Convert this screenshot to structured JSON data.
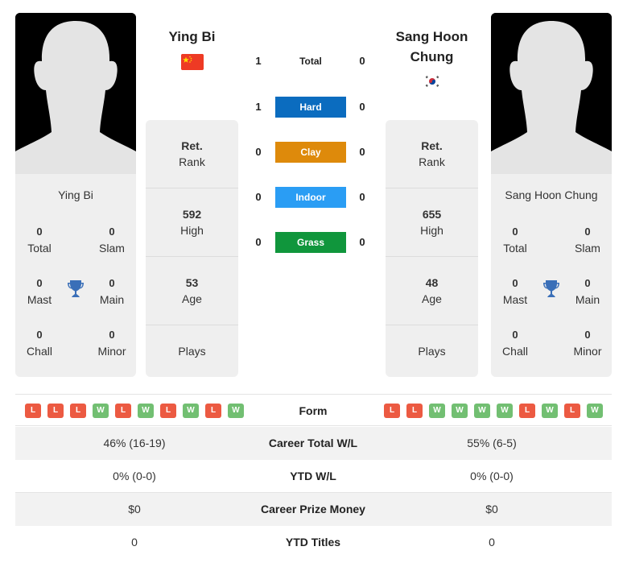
{
  "player1": {
    "name": "Ying Bi",
    "header_name": "Ying Bi",
    "flag": "china-flag",
    "titles": {
      "total": {
        "value": "0",
        "label": "Total"
      },
      "slam": {
        "value": "0",
        "label": "Slam"
      },
      "mast": {
        "value": "0",
        "label": "Mast"
      },
      "main": {
        "value": "0",
        "label": "Main"
      },
      "chall": {
        "value": "0",
        "label": "Chall"
      },
      "minor": {
        "value": "0",
        "label": "Minor"
      }
    },
    "info": {
      "rank": {
        "value": "Ret.",
        "label": "Rank"
      },
      "high": {
        "value": "592",
        "label": "High"
      },
      "age": {
        "value": "53",
        "label": "Age"
      },
      "plays": {
        "value": "",
        "label": "Plays"
      }
    },
    "form": [
      "L",
      "L",
      "L",
      "W",
      "L",
      "W",
      "L",
      "W",
      "L",
      "W"
    ]
  },
  "player2": {
    "name": "Sang Hoon Chung",
    "header_name": "Sang Hoon Chung",
    "flag": "south-korea-flag",
    "titles": {
      "total": {
        "value": "0",
        "label": "Total"
      },
      "slam": {
        "value": "0",
        "label": "Slam"
      },
      "mast": {
        "value": "0",
        "label": "Mast"
      },
      "main": {
        "value": "0",
        "label": "Main"
      },
      "chall": {
        "value": "0",
        "label": "Chall"
      },
      "minor": {
        "value": "0",
        "label": "Minor"
      }
    },
    "info": {
      "rank": {
        "value": "Ret.",
        "label": "Rank"
      },
      "high": {
        "value": "655",
        "label": "High"
      },
      "age": {
        "value": "48",
        "label": "Age"
      },
      "plays": {
        "value": "",
        "label": "Plays"
      }
    },
    "form": [
      "L",
      "L",
      "W",
      "W",
      "W",
      "W",
      "L",
      "W",
      "L",
      "W"
    ]
  },
  "h2h": [
    {
      "label": "Total",
      "p1": "1",
      "p2": "0",
      "color": ""
    },
    {
      "label": "Hard",
      "p1": "1",
      "p2": "0",
      "color": "#0b6cbf"
    },
    {
      "label": "Clay",
      "p1": "0",
      "p2": "0",
      "color": "#de8a0b"
    },
    {
      "label": "Indoor",
      "p1": "0",
      "p2": "0",
      "color": "#2a9df4"
    },
    {
      "label": "Grass",
      "p1": "0",
      "p2": "0",
      "color": "#10963c"
    }
  ],
  "form_label": "Form",
  "comparison": [
    {
      "label": "Career Total W/L",
      "p1": "46% (16-19)",
      "p2": "55% (6-5)"
    },
    {
      "label": "YTD W/L",
      "p1": "0% (0-0)",
      "p2": "0% (0-0)"
    },
    {
      "label": "Career Prize Money",
      "p1": "$0",
      "p2": "$0"
    },
    {
      "label": "YTD Titles",
      "p1": "0",
      "p2": "0"
    }
  ],
  "colors": {
    "loss": "#ec5a42",
    "win": "#72bf72",
    "trophy": "#3a6fb8",
    "card_bg": "#efefef"
  }
}
